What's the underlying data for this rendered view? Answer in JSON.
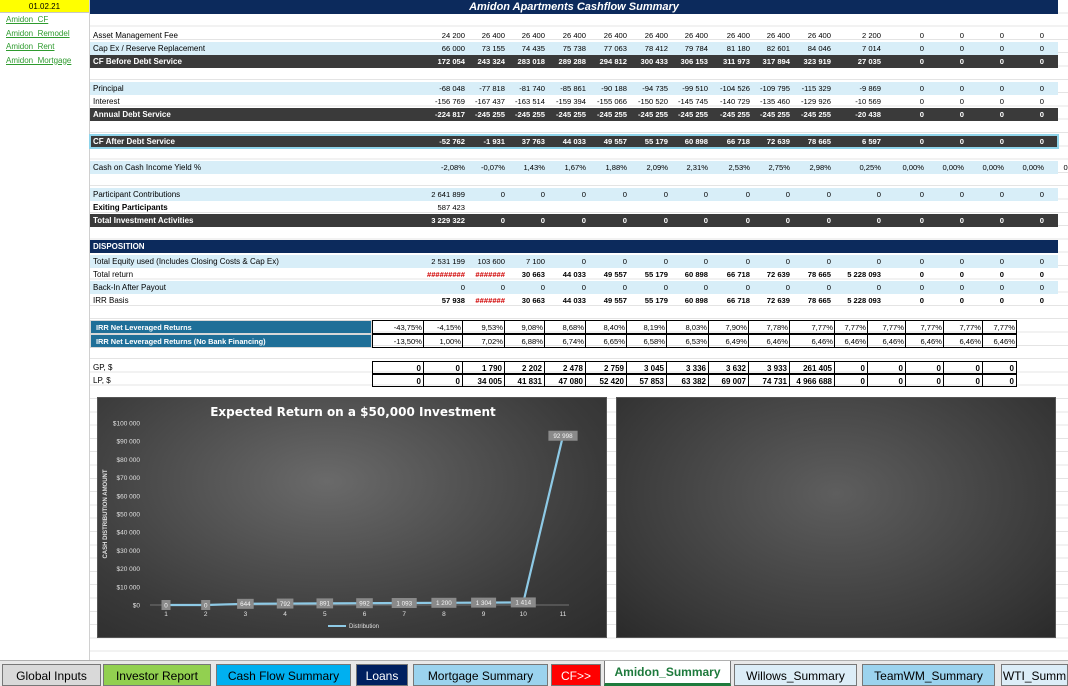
{
  "sheet": {
    "date": "01.02.21",
    "links": [
      "Amidon_CF",
      "Amidon_Remodel",
      "Amidon_Rent",
      "Amidon_Mortgage"
    ],
    "title": "Amidon Apartments Cashflow Summary"
  },
  "table": [
    {
      "label": "Asset Management Fee",
      "style": "plain",
      "values": [
        "24 200",
        "26 400",
        "26 400",
        "26 400",
        "26 400",
        "26 400",
        "26 400",
        "26 400",
        "26 400",
        "26 400",
        "2 200",
        "0",
        "0",
        "0",
        "0",
        "0"
      ]
    },
    {
      "label": "Cap Ex / Reserve Replacement",
      "style": "light",
      "values": [
        "66 000",
        "73 155",
        "74 435",
        "75 738",
        "77 063",
        "78 412",
        "79 784",
        "81 180",
        "82 601",
        "84 046",
        "7 014",
        "0",
        "0",
        "0",
        "0",
        "0"
      ]
    },
    {
      "label": "CF Before Debt Service",
      "style": "dark",
      "values": [
        "172 054",
        "243 324",
        "283 018",
        "289 288",
        "294 812",
        "300 433",
        "306 153",
        "311 973",
        "317 894",
        "323 919",
        "27 035",
        "0",
        "0",
        "0",
        "0",
        "0"
      ]
    },
    {
      "label": "",
      "style": "blank",
      "values": []
    },
    {
      "label": "Principal",
      "style": "light",
      "values": [
        "-68 048",
        "-77 818",
        "-81 740",
        "-85 861",
        "-90 188",
        "-94 735",
        "-99 510",
        "-104 526",
        "-109 795",
        "-115 329",
        "-9 869",
        "0",
        "0",
        "0",
        "0",
        "0"
      ]
    },
    {
      "label": "Interest",
      "style": "plain",
      "values": [
        "-156 769",
        "-167 437",
        "-163 514",
        "-159 394",
        "-155 066",
        "-150 520",
        "-145 745",
        "-140 729",
        "-135 460",
        "-129 926",
        "-10 569",
        "0",
        "0",
        "0",
        "0",
        "0"
      ]
    },
    {
      "label": "Annual Debt Service",
      "style": "dark",
      "values": [
        "-224 817",
        "-245 255",
        "-245 255",
        "-245 255",
        "-245 255",
        "-245 255",
        "-245 255",
        "-245 255",
        "-245 255",
        "-245 255",
        "-20 438",
        "0",
        "0",
        "0",
        "0",
        "0"
      ]
    },
    {
      "label": "",
      "style": "blank",
      "values": []
    },
    {
      "label": "CF After Debt Service",
      "style": "darksel",
      "values": [
        "-52 762",
        "-1 931",
        "37 763",
        "44 033",
        "49 557",
        "55 179",
        "60 898",
        "66 718",
        "72 639",
        "78 665",
        "6 597",
        "0",
        "0",
        "0",
        "0",
        "0"
      ]
    },
    {
      "label": "",
      "style": "blank",
      "values": []
    },
    {
      "label": "Cash on Cash Income Yield %",
      "style": "light",
      "values": [
        "-2,08%",
        "-0,07%",
        "1,43%",
        "1,67%",
        "1,88%",
        "2,09%",
        "2,31%",
        "2,53%",
        "2,75%",
        "2,98%",
        "0,25%",
        "0,00%",
        "0,00%",
        "0,00%",
        "0,00%",
        "0,00%"
      ]
    },
    {
      "label": "",
      "style": "blank",
      "values": []
    },
    {
      "label": "Participant Contributions",
      "style": "light",
      "values": [
        "2 641 899",
        "0",
        "0",
        "0",
        "0",
        "0",
        "0",
        "0",
        "0",
        "0",
        "0",
        "0",
        "0",
        "0",
        "0",
        "0"
      ]
    },
    {
      "label": "Exiting Participants",
      "style": "boldplain",
      "values": [
        "587 423"
      ]
    },
    {
      "label": "Total Investment Activities",
      "style": "dark",
      "values": [
        "3 229 322",
        "0",
        "0",
        "0",
        "0",
        "0",
        "0",
        "0",
        "0",
        "0",
        "0",
        "0",
        "0",
        "0",
        "0",
        "0"
      ]
    },
    {
      "label": "",
      "style": "blank",
      "values": []
    },
    {
      "label": "DISPOSITION",
      "style": "navy",
      "values": []
    },
    {
      "label": "Total Equity used (Includes Closing Costs & Cap Ex)",
      "style": "light",
      "values": [
        "2 531 199",
        "103 600",
        "7 100",
        "0",
        "0",
        "0",
        "0",
        "0",
        "0",
        "0",
        "0",
        "0",
        "0",
        "0",
        "0",
        "0"
      ]
    },
    {
      "label": "Total return",
      "style": "plainret",
      "values": [
        "#########",
        "#######",
        "30 663",
        "44 033",
        "49 557",
        "55 179",
        "60 898",
        "66 718",
        "72 639",
        "78 665",
        "5 228 093",
        "0",
        "0",
        "0",
        "0",
        "0"
      ]
    },
    {
      "label": "Back-In After Payout",
      "style": "light",
      "values": [
        "0",
        "0",
        "0",
        "0",
        "0",
        "0",
        "0",
        "0",
        "0",
        "0",
        "0",
        "0",
        "0",
        "0",
        "0",
        "0"
      ]
    },
    {
      "label": "IRR Basis",
      "style": "plainret",
      "values": [
        "57 938",
        "#######",
        "30 663",
        "44 033",
        "49 557",
        "55 179",
        "60 898",
        "66 718",
        "72 639",
        "78 665",
        "5 228 093",
        "0",
        "0",
        "0",
        "0",
        "0"
      ]
    }
  ],
  "irr": [
    {
      "label": "IRR Net Leveraged Returns",
      "values": [
        "-43,75%",
        "-4,15%",
        "9,53%",
        "9,08%",
        "8,68%",
        "8,40%",
        "8,19%",
        "8,03%",
        "7,90%",
        "7,78%",
        "7,77%",
        "7,77%",
        "7,77%",
        "7,77%",
        "7,77%",
        "7,77%"
      ]
    },
    {
      "label": "IRR Net Leveraged Returns (No Bank Financing)",
      "values": [
        "-13,50%",
        "1,00%",
        "7,02%",
        "6,88%",
        "6,74%",
        "6,65%",
        "6,58%",
        "6,53%",
        "6,49%",
        "6,46%",
        "6,46%",
        "6,46%",
        "6,46%",
        "6,46%",
        "6,46%",
        "6,46%"
      ]
    }
  ],
  "gplp": [
    {
      "label": "GP, $",
      "values": [
        "0",
        "0",
        "1 790",
        "2 202",
        "2 478",
        "2 759",
        "3 045",
        "3 336",
        "3 632",
        "3 933",
        "261 405",
        "0",
        "0",
        "0",
        "0",
        "0"
      ]
    },
    {
      "label": "LP, $",
      "values": [
        "0",
        "0",
        "34 005",
        "41 831",
        "47 080",
        "52 420",
        "57 853",
        "63 382",
        "69 007",
        "74 731",
        "4 966 688",
        "0",
        "0",
        "0",
        "0",
        "0"
      ]
    }
  ],
  "chart_data": {
    "type": "line",
    "title": "Expected Return on a $50,000 Investment",
    "ylabel": "CASH DISTRIBUTION AMOUNT",
    "xlabel": "",
    "ylim": [
      0,
      100000
    ],
    "yticks": [
      "$0",
      "$10 000",
      "$20 000",
      "$30 000",
      "$40 000",
      "$50 000",
      "$60 000",
      "$70 000",
      "$80 000",
      "$90 000",
      "$100 000"
    ],
    "categories": [
      "1",
      "2",
      "3",
      "4",
      "5",
      "6",
      "7",
      "8",
      "9",
      "10",
      "11"
    ],
    "series": [
      {
        "name": "Distribution",
        "values": [
          0,
          0,
          644,
          792,
          891,
          992,
          1093,
          1200,
          1304,
          1414,
          92998
        ],
        "labels": [
          "0",
          "0",
          "644",
          "792",
          "891",
          "992",
          "1 093",
          "1 200",
          "1 304",
          "1 414",
          "92 998"
        ]
      }
    ],
    "legend": "bottom",
    "colors": {
      "line": "#8ecae6",
      "bg": "#454545"
    }
  },
  "tabs": [
    {
      "label": "Global Inputs",
      "bg": "#d9d9d9",
      "fg": "#000"
    },
    {
      "label": "Investor Report",
      "bg": "#92d050",
      "fg": "#000"
    },
    {
      "label": "Cash Flow Summary",
      "bg": "#00b0f0",
      "fg": "#000"
    },
    {
      "label": "Loans",
      "bg": "#002060",
      "fg": "#fff"
    },
    {
      "label": "Mortgage Summary",
      "bg": "#9bd3ee",
      "fg": "#000"
    },
    {
      "label": "CF>>",
      "bg": "#ff0000",
      "fg": "#fff"
    },
    {
      "label": "Amidon_Summary",
      "bg": "#ffffff",
      "fg": "#1e7a3c",
      "active": true
    },
    {
      "label": "Willows_Summary",
      "bg": "#dcedf7",
      "fg": "#000"
    },
    {
      "label": "TeamWM_Summary",
      "bg": "#9bd3ee",
      "fg": "#000"
    },
    {
      "label": "WTI_Summ",
      "bg": "#dcedf7",
      "fg": "#000"
    }
  ]
}
